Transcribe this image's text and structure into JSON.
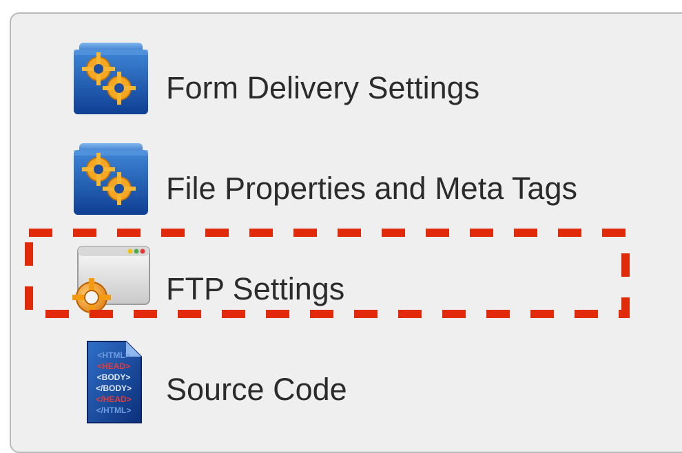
{
  "menu": {
    "items": [
      {
        "label": "Form Delivery Settings",
        "icon": "folder-gears-icon"
      },
      {
        "label": "File Properties and Meta Tags",
        "icon": "folder-gears-icon"
      },
      {
        "label": "FTP Settings",
        "icon": "window-gear-icon"
      },
      {
        "label": "Source Code",
        "icon": "html-source-file-icon"
      }
    ]
  },
  "source_icon_text": [
    "<HTML>",
    "<HEAD>",
    "<BODY>",
    "</BODY>",
    "</HEAD>",
    "</HTML>"
  ],
  "highlight": {
    "style": "dashed",
    "color": "#e02a0a",
    "target": "FTP Settings"
  },
  "colors": {
    "panel_bg": "#efefef",
    "panel_border": "#b9b9b9",
    "text": "#2b2b2b",
    "highlight": "#e02a0a"
  }
}
